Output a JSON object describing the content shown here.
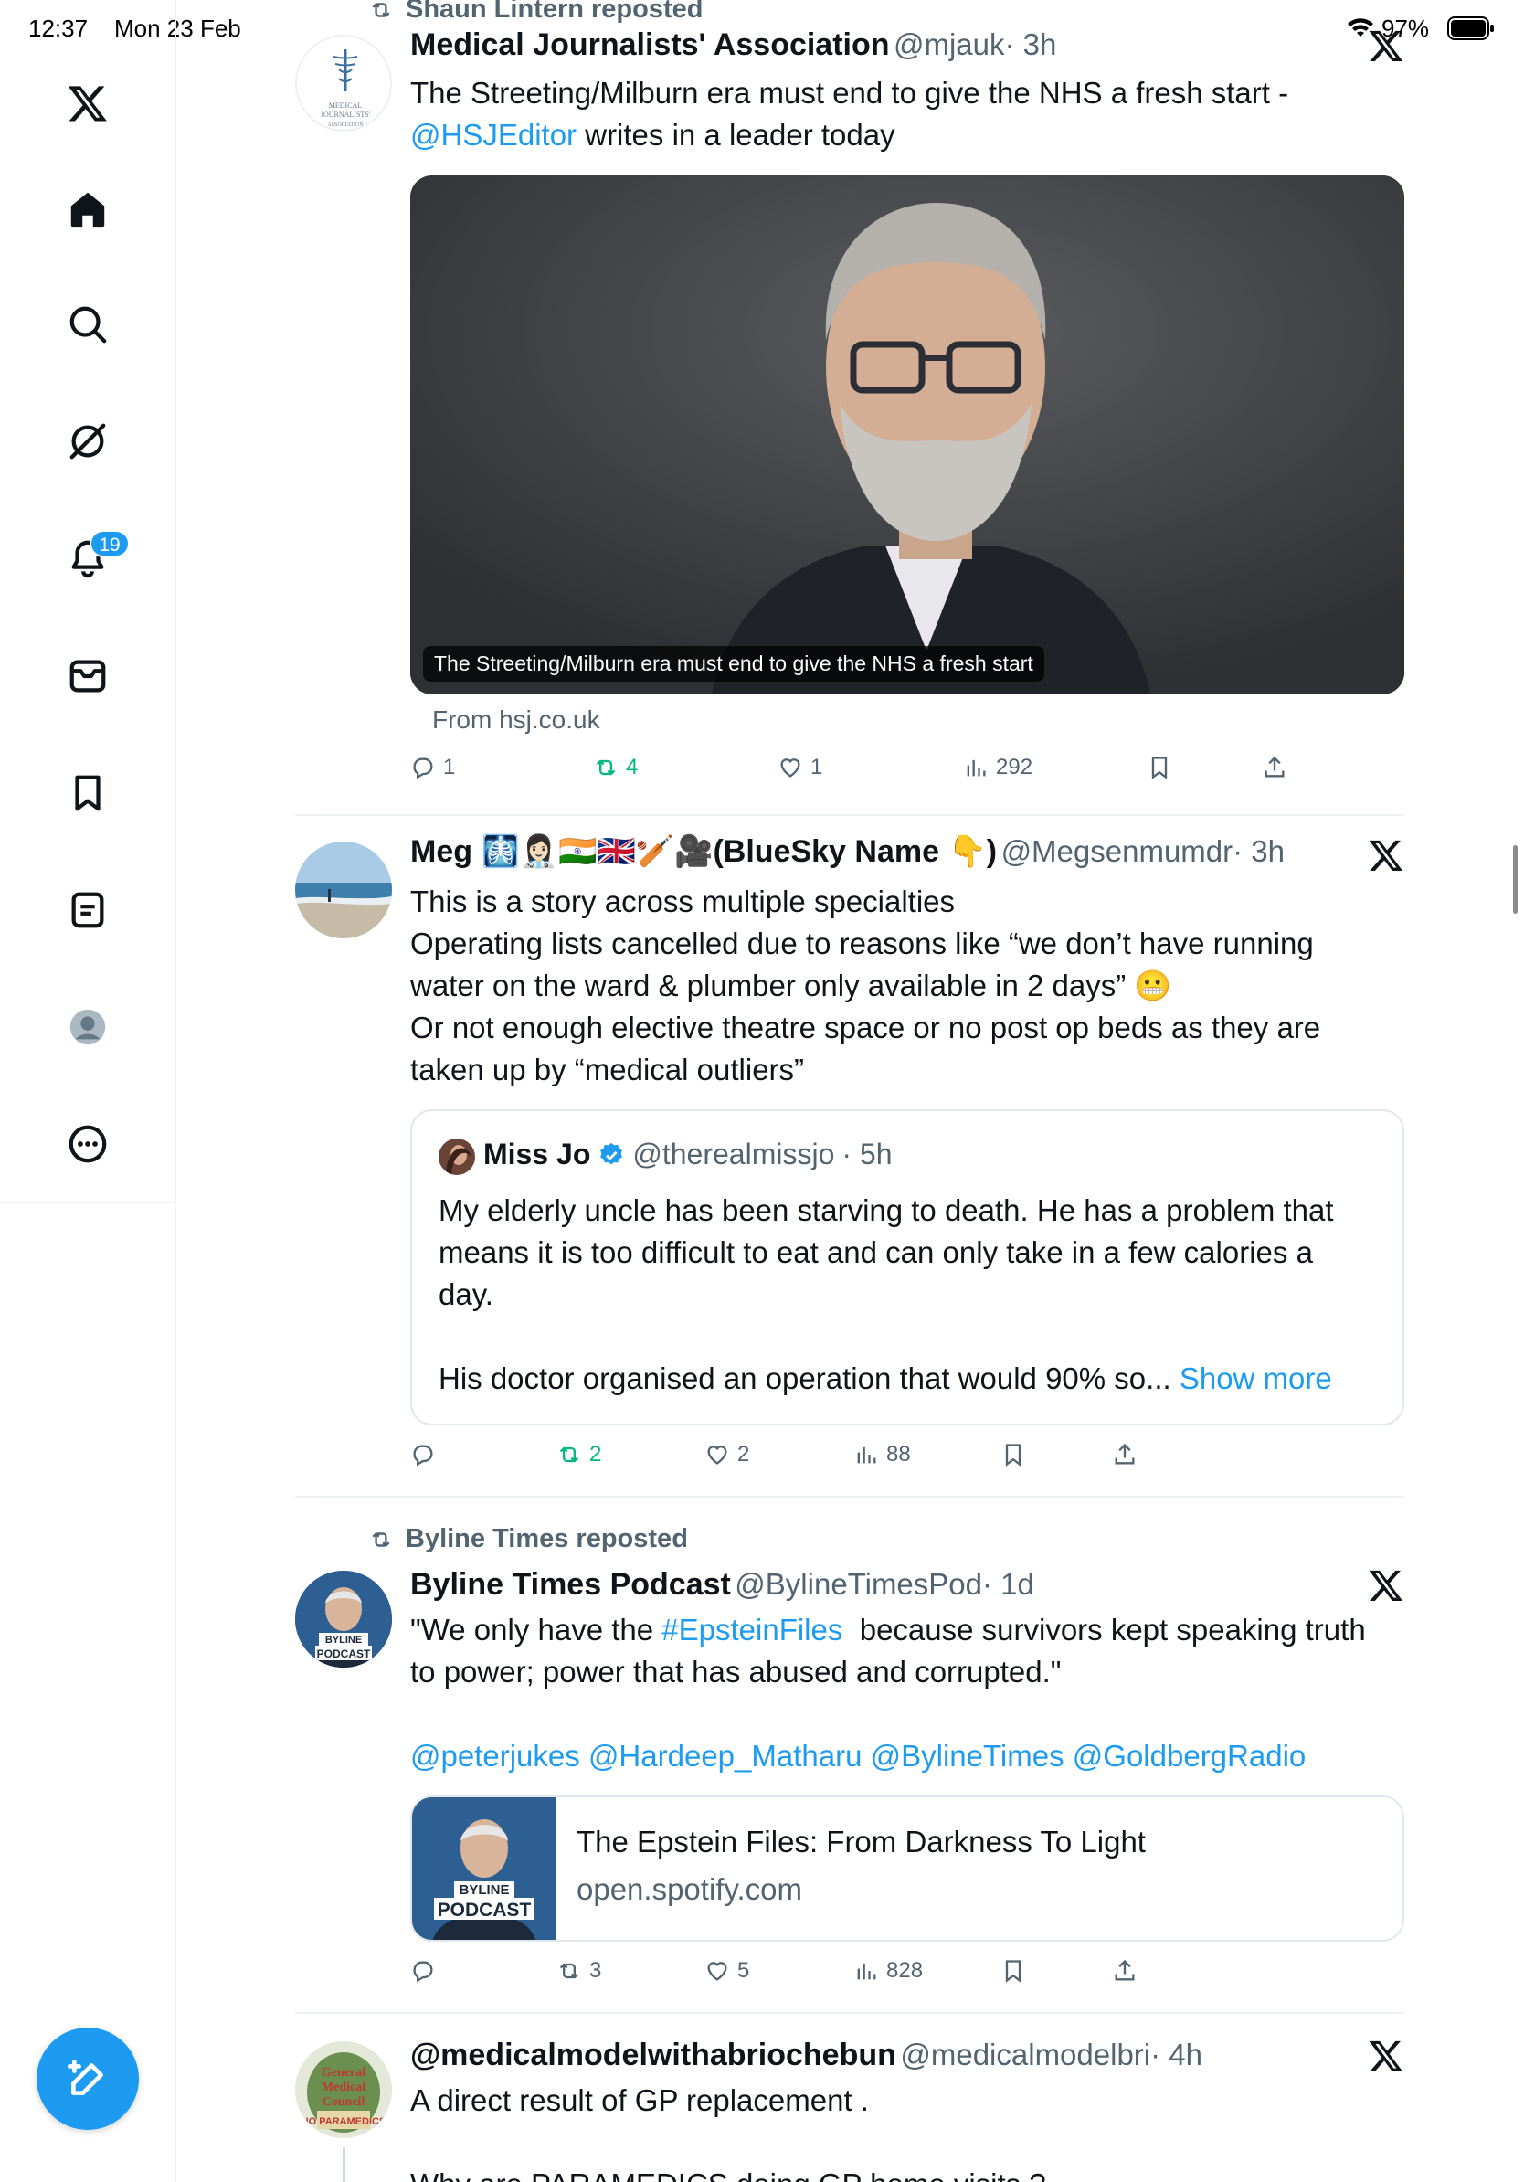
{
  "status_bar": {
    "time": "12:37",
    "date": "Mon 23 Feb",
    "battery": "97%"
  },
  "sidebar": {
    "notifications_badge": "19"
  },
  "tweets": [
    {
      "reposted_by": "Shaun Lintern reposted",
      "name": "Medical Journalists' Association",
      "handle": "@mjauk",
      "time": "· 3h",
      "text_part1": "The Streeting/Milburn era must end to give the NHS a fresh start -",
      "text_link": "@HSJEditor",
      "text_part2": " writes in a leader today",
      "avatar_text": "MEDICAL JOURNALISTS' ASSOCIATION",
      "media_caption": "The Streeting/Milburn era must end to give the NHS a fresh start",
      "source": "From hsj.co.uk",
      "stats": {
        "replies": "1",
        "reposts": "4",
        "likes": "1",
        "views": "292"
      }
    },
    {
      "name": "Meg 🩻👩🏻‍⚕️🇮🇳🇬🇧🏏🎥(BlueSky Name 👇)",
      "handle": "@Megsenmumdr",
      "time": "· 3h",
      "lines": [
        "This is a story across multiple specialties",
        "Operating lists cancelled due to reasons like “we don’t have running",
        "water on the ward & plumber only available in 2 days” 😬",
        "Or not enough elective theatre space or no post op beds as they are",
        "taken up by “medical outliers”"
      ],
      "quote": {
        "name": "Miss Jo",
        "handle": "@therealmissjo",
        "time": "· 5h",
        "lines": [
          "My elderly uncle has been starving to death. He has a problem that",
          "means it is too difficult to eat and can only take in a few calories a",
          "day."
        ],
        "last_line": "His doctor organised an operation that would 90% so...",
        "show_more": "Show more"
      },
      "stats": {
        "replies": "",
        "reposts": "2",
        "likes": "2",
        "views": "88"
      }
    },
    {
      "reposted_by": "Byline Times reposted",
      "name": "Byline Times Podcast",
      "handle": "@BylineTimesPod",
      "time": "· 1d",
      "text_a": "\"We only have the ",
      "hashtag": "#EpsteinFiles",
      "text_b": "  because survivors kept speaking truth",
      "text_line2": "to power; power that has abused and corrupted.\"",
      "mentions": [
        "@peterjukes",
        "@Hardeep_Matharu",
        "@BylineTimes",
        "@GoldbergRadio"
      ],
      "card_title": "The Epstein Files: From Darkness To Light",
      "card_domain": "open.spotify.com",
      "avatar_text_1": "BYLINE",
      "avatar_text_2": "PODCAST",
      "stats": {
        "replies": "",
        "reposts": "3",
        "likes": "5",
        "views": "828"
      }
    },
    {
      "name": "@medicalmodelwithabriochebun",
      "handle": "@medicalmodelbri",
      "time": "· 4h",
      "text": "A direct result of GP replacement .",
      "text_cut": "Why are PARAMEDICS doing GP home visits ?",
      "avatar_text": "General Medical Council NO PARAMEDICS"
    }
  ],
  "colors": {
    "accent": "#1d9bf0",
    "repost_green": "#00ba7c",
    "secondary_text": "#536471"
  },
  "icons": [
    "x-logo",
    "home-icon",
    "search-icon",
    "grok-icon",
    "bell-icon",
    "mail-icon",
    "bookmark-icon",
    "list-icon",
    "profile-icon",
    "more-icon",
    "compose-icon"
  ]
}
